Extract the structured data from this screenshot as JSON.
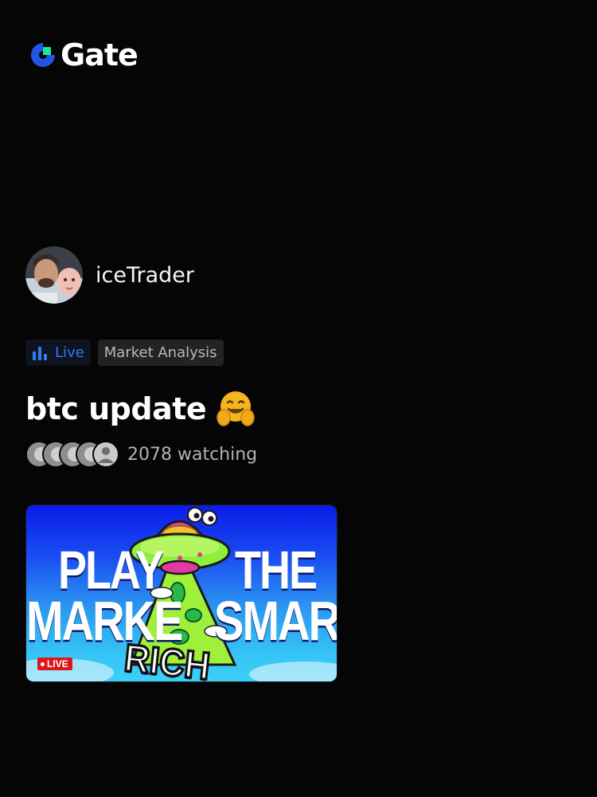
{
  "header": {
    "logo_text": "Gate",
    "logo_icon": "gate-logo-icon",
    "brand_colors": {
      "blue": "#2354e6",
      "green": "#17e5a0"
    }
  },
  "host": {
    "name": "iceTrader",
    "avatar_icon": "host-avatar"
  },
  "tags": {
    "live_label": "Live",
    "live_icon": "bar-chart-icon",
    "live_color": "#2f7cf6",
    "category": "Market Analysis"
  },
  "stream": {
    "title": "btc update",
    "title_emoji_icon": "hugging-face-emoji-icon"
  },
  "viewers": {
    "count_text": "2078 watching",
    "avatar_count": 5
  },
  "thumbnail": {
    "line1_left": "PLAY",
    "line1_right": "THE",
    "line2_left": "MARKE",
    "line2_right": "SMART",
    "bottom_word": "RICH",
    "live_badge": "LIVE",
    "live_badge_color": "#e0151b"
  }
}
